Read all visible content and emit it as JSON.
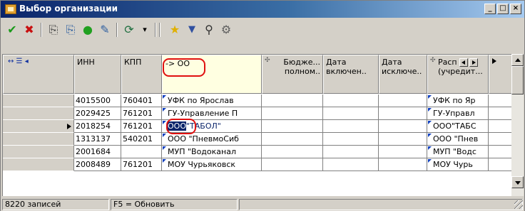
{
  "window": {
    "title": "Выбор организации",
    "title_bar_color": "#0a246a",
    "buttons": [
      "_",
      "□",
      "×"
    ]
  },
  "toolbar": {
    "icons": [
      {
        "name": "check-icon",
        "glyph": "✔",
        "color": "#1a9a1a"
      },
      {
        "name": "delete-icon",
        "glyph": "✖",
        "color": "#c81010"
      },
      {
        "name": "copy-icon",
        "glyph": "⎘",
        "color": "#404040"
      },
      {
        "name": "paste-icon",
        "glyph": "⎘",
        "color": "#3060a0"
      },
      {
        "name": "add-icon",
        "glyph": "●",
        "color": "#20a020"
      },
      {
        "name": "edit-icon",
        "glyph": "✎",
        "color": "#3060a0"
      },
      {
        "name": "refresh-icon",
        "glyph": "⟳",
        "color": "#207040"
      },
      {
        "name": "dropdown-icon",
        "glyph": "▾",
        "color": "#000"
      },
      {
        "name": "favorite-star-icon",
        "glyph": "★",
        "color": "#e0b000"
      },
      {
        "name": "filter-icon",
        "glyph": "▼",
        "color": "#3050a0"
      },
      {
        "name": "binoculars-icon",
        "glyph": "⚲",
        "color": "#303030"
      },
      {
        "name": "settings-icon",
        "glyph": "⚙",
        "color": "#606060"
      }
    ]
  },
  "grid": {
    "columns": [
      {
        "key": "inn",
        "header": "ИНН"
      },
      {
        "key": "kpp",
        "header": "КПП"
      },
      {
        "key": "name",
        "header": "",
        "filter_value": "-> ОО"
      },
      {
        "key": "budget",
        "header": "Бюдже...\nполном.."
      },
      {
        "key": "date_in",
        "header": "Дата\nвключен.."
      },
      {
        "key": "date_out",
        "header": "Дата\nисключе.."
      },
      {
        "key": "rasp",
        "header": "Расп\n(учредит..."
      }
    ],
    "rows": [
      {
        "inn": "4015500",
        "kpp": "760401",
        "name": "УФК по Ярослав",
        "rasp": "УФК по Яр"
      },
      {
        "inn": "2029425",
        "kpp": "761201",
        "name": "ГУ-Управление П",
        "rasp": "ГУ-Управл"
      },
      {
        "inn": "2018254",
        "kpp": "761201",
        "name_hl": "ООО",
        "name_rest": "\"ТАБОЛ\"",
        "rasp": "ООО\"ТАБС"
      },
      {
        "inn": "1313137",
        "kpp": "540201",
        "name": "ООО \"ПневмоСиб",
        "rasp": "ООО \"Пнев"
      },
      {
        "inn": "2001684",
        "kpp": "",
        "name": "МУП \"Водоканал",
        "rasp": "МУП \"Водс"
      },
      {
        "inn": "2008489",
        "kpp": "761201",
        "name": "МОУ Чурьяковск",
        "rasp": "МОУ Чурь"
      }
    ],
    "selected_row": 2
  },
  "status": {
    "count": "8220 записей",
    "hint": "F5 = Обновить"
  }
}
